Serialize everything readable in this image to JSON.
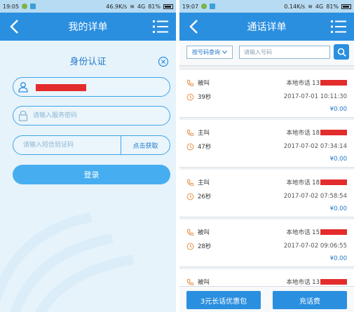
{
  "left": {
    "status": {
      "time": "19:05",
      "speed": "46.9K/s",
      "network": "4G",
      "battery": "81%"
    },
    "header": {
      "title": "我的详单"
    },
    "form": {
      "title": "身份认证",
      "password_placeholder": "请输入服务密码",
      "sms_placeholder": "请输入短信验证码",
      "sms_button": "点击获取",
      "login_button": "登录"
    }
  },
  "right": {
    "status": {
      "time": "19:07",
      "speed": "0.14K/s",
      "network": "4G",
      "battery": "81%"
    },
    "header": {
      "title": "通话详单"
    },
    "search": {
      "select_label": "按号码查询",
      "placeholder": "请输入号码"
    },
    "records": [
      {
        "type": "被叫",
        "location": "本地市话 13",
        "duration": "39秒",
        "datetime": "2017-07-01 10:11:30",
        "fee": "¥0.00"
      },
      {
        "type": "主叫",
        "location": "本地市话 18",
        "duration": "47秒",
        "datetime": "2017-07-02 07:34:14",
        "fee": "¥0.00"
      },
      {
        "type": "主叫",
        "location": "本地市话 18",
        "duration": "26秒",
        "datetime": "2017-07-02 07:58:54",
        "fee": "¥0.00"
      },
      {
        "type": "被叫",
        "location": "本地市话 15",
        "duration": "28秒",
        "datetime": "2017-07-02 09:06:55",
        "fee": "¥0.00"
      },
      {
        "type": "被叫",
        "location": "本地市话 13",
        "duration": "",
        "datetime": "",
        "fee": ""
      }
    ],
    "bottom": {
      "package_button": "3元长话优惠包",
      "recharge_button": "充话费"
    }
  },
  "colors": {
    "accent": "#2b8fe0",
    "redaction": "#e32c2c",
    "header_bg": "#2b8fe0"
  }
}
